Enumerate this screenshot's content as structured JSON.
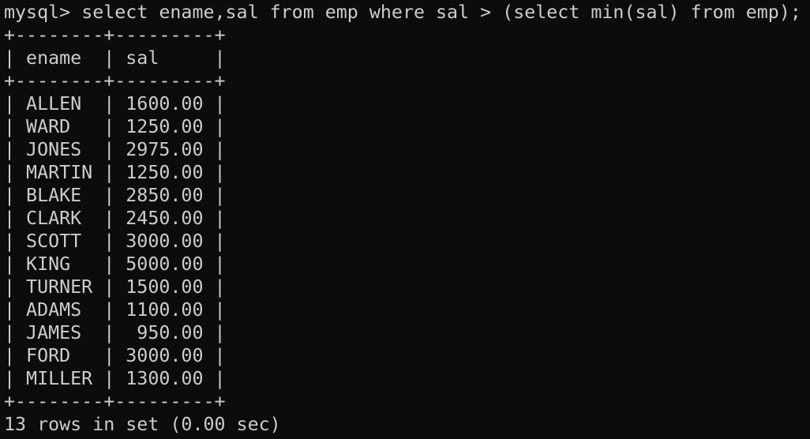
{
  "terminal": {
    "prompt": "mysql> ",
    "command": "select ename,sal from emp where sal > (select min(sal) from emp);",
    "border": "+--------+---------+",
    "header_row": "| ename  | sal     |",
    "rows": [
      "| ALLEN  | 1600.00 |",
      "| WARD   | 1250.00 |",
      "| JONES  | 2975.00 |",
      "| MARTIN | 1250.00 |",
      "| BLAKE  | 2850.00 |",
      "| CLARK  | 2450.00 |",
      "| SCOTT  | 3000.00 |",
      "| KING   | 5000.00 |",
      "| TURNER | 1500.00 |",
      "| ADAMS  | 1100.00 |",
      "| JAMES  |  950.00 |",
      "| FORD   | 3000.00 |",
      "| MILLER | 1300.00 |"
    ],
    "footer": "13 rows in set (0.00 sec)"
  }
}
